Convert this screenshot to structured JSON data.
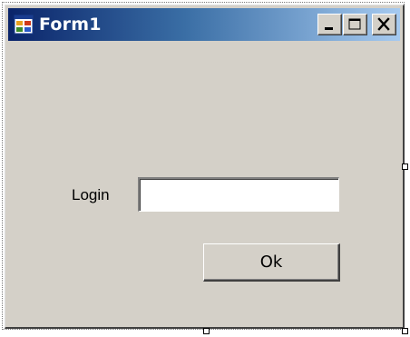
{
  "window": {
    "title": "Form1",
    "icon": "form-app-icon",
    "controls": {
      "minimize": "minimize-icon",
      "maximize": "maximize-icon",
      "close": "close-icon"
    }
  },
  "form": {
    "login_label": "Login",
    "login_value": "",
    "ok_label": "Ok"
  },
  "colors": {
    "title_gradient_start": "#0a246a",
    "title_gradient_end": "#a6caf0",
    "face": "#d4d0c8"
  }
}
